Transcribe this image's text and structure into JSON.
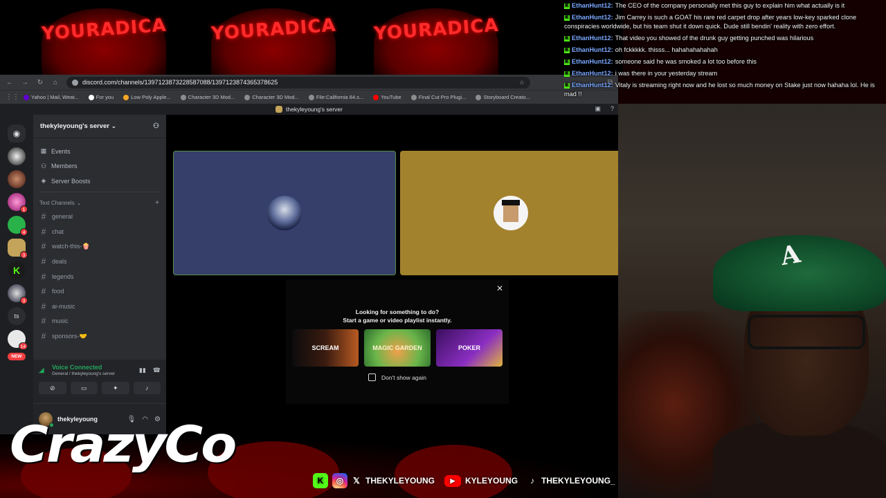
{
  "background": {
    "hat_text": "YOURADICA"
  },
  "chat": {
    "messages": [
      {
        "user": "EthanHunt12:",
        "text": "The CEO of the company personally met this guy to explain him what actually is it",
        "wrap": false
      },
      {
        "user": "EthanHunt12:",
        "text": "Jim Carrey is such a GOAT his rare red carpet drop after years low-key sparked clone conspiracies worldwide, but his team shut it down quick. Dude still bendin' reality with zero effort.",
        "wrap": true
      },
      {
        "user": "EthanHunt12:",
        "text": "That video you showed of the drunk guy getting punched was hilarious",
        "wrap": false
      },
      {
        "user": "EthanHunt12:",
        "text": "oh fckkkkk. thisss... hahahahahahah",
        "wrap": false
      },
      {
        "user": "EthanHunt12:",
        "text": "someone said he was smoked a lot too before this",
        "wrap": false
      },
      {
        "user": "EthanHunt12:",
        "text": "i was there in your yesterday stream",
        "wrap": false
      },
      {
        "user": "EthanHunt12:",
        "text": "Vitaly is streaming right now and he lost so much money on Stake just now hahaha lol. He is mad !!",
        "wrap": true
      }
    ]
  },
  "browser": {
    "url": "discord.com/channels/1397123873228587088/1397123874365378625",
    "bookmarks": [
      "Yahoo | Mail, Weat...",
      "For you",
      "Low Poly Apple...",
      "Character 3D Mod...",
      "Character 3D Mod...",
      "File:California 84.s...",
      "YouTube",
      "Final Cut Pro Plugi...",
      "Storyboard Creato..."
    ]
  },
  "discord": {
    "window_title": "thekyleyoung's server",
    "server_name": "thekyleyoung's server",
    "links": [
      {
        "icon": "calendar-icon",
        "glyph": "▦",
        "label": "Events"
      },
      {
        "icon": "members-icon",
        "glyph": "👥",
        "label": "Members"
      },
      {
        "icon": "boost-icon",
        "glyph": "◈",
        "label": "Server Boosts"
      }
    ],
    "category": "Text Channels",
    "channels": [
      "general",
      "chat",
      "watch-this-🍿",
      "deals",
      "legends",
      "food",
      "ai-music",
      "music",
      "sponsors-🤝"
    ],
    "guild_badges": {
      "g3": "1",
      "g4": "4",
      "g5": "3",
      "g7": "3",
      "g9": "14"
    },
    "guild_text": "ts",
    "new_label": "NEW",
    "voice": {
      "status": "Voice Connected",
      "location": "General / thekyleyoung's server"
    },
    "user": {
      "name": "thekyleyoung"
    },
    "activity": {
      "line1": "Looking for something to do?",
      "line2": "Start a game or video playlist instantly.",
      "games": [
        "SCREAM",
        "MAGIC GARDEN",
        "POKER"
      ],
      "dont_show": "Don't show again"
    }
  },
  "overlay": {
    "brand": "CrazyCo",
    "socials": [
      {
        "icon": "instagram-icon",
        "label": ""
      },
      {
        "icon": "x-icon",
        "label": "THEKYLEYOUNG"
      },
      {
        "icon": "youtube-icon",
        "label": "KYLEYOUNG"
      },
      {
        "icon": "tiktok-icon",
        "label": "THEKYLEYOUNG_"
      }
    ]
  },
  "cam": {
    "cap_logo": "A"
  }
}
